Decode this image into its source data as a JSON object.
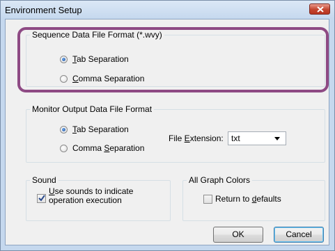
{
  "window": {
    "title": "Environment Setup"
  },
  "sequence_group": {
    "legend": "Sequence Data File Format (*.wvy)",
    "options": [
      {
        "label": "Tab Separation",
        "mnemonic": "T",
        "selected": true
      },
      {
        "label": "Comma Separation",
        "mnemonic": "C",
        "selected": false
      }
    ]
  },
  "monitor_group": {
    "legend": "Monitor Output Data File Format",
    "options": [
      {
        "label": "Tab Separation",
        "mnemonic": "T",
        "selected": true
      },
      {
        "label": "Comma Separation",
        "mnemonic": "S",
        "selected": false
      }
    ],
    "extension_label": "File Extension:",
    "extension_value": "txt"
  },
  "sound_group": {
    "legend": "Sound",
    "checkbox_label_line1": "Use sounds to indicate",
    "checkbox_label_line2": "operation execution",
    "checked": true
  },
  "graph_group": {
    "legend": "All Graph Colors",
    "checkbox_label": "Return to defaults",
    "checked": false
  },
  "buttons": {
    "ok": "OK",
    "cancel": "Cancel"
  },
  "colors": {
    "highlight_ring": "#8e4a84",
    "close_button": "#c4452f"
  }
}
